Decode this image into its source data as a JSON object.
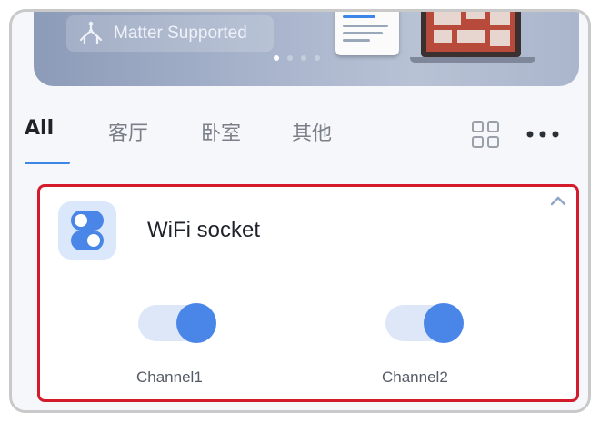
{
  "banner": {
    "matter_label": "Matter Supported",
    "carousel": {
      "count": 4,
      "active": 0
    }
  },
  "tabs": [
    {
      "label": "All",
      "active": true
    },
    {
      "label": "客厅",
      "active": false
    },
    {
      "label": "卧室",
      "active": false
    },
    {
      "label": "其他",
      "active": false
    }
  ],
  "toolbar": {
    "grid_icon": "grid-view-icon",
    "more_icon": "more-horizontal-icon"
  },
  "device": {
    "name": "WiFi socket",
    "icon": "toggle-switch-icon",
    "collapse_icon": "chevron-up-icon",
    "channels": [
      {
        "label": "Channel1",
        "on": true
      },
      {
        "label": "Channel2",
        "on": true
      }
    ]
  },
  "colors": {
    "accent": "#4a86e8",
    "highlight_border": "#d41b2c",
    "toggle_track": "#dde7f8"
  }
}
